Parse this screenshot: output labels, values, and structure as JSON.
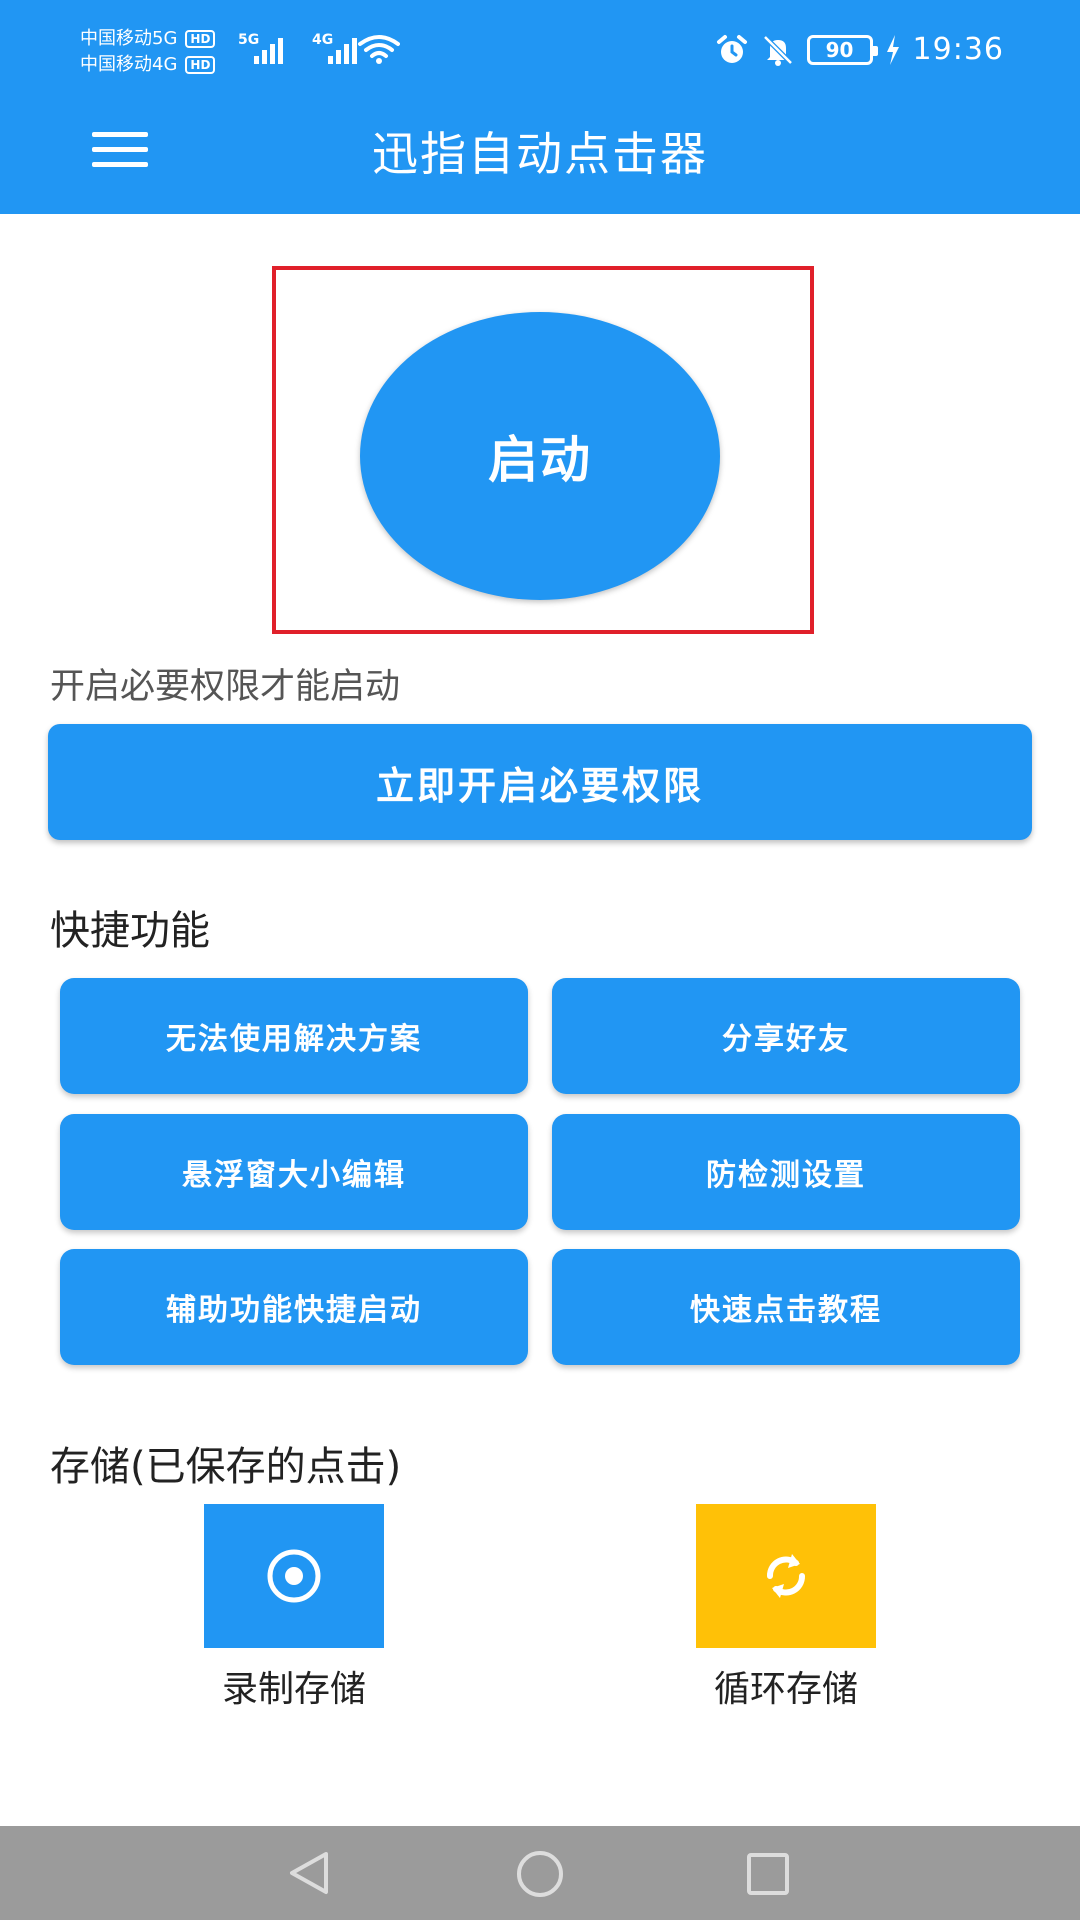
{
  "status_bar": {
    "carrier1": "中国移动5G",
    "carrier2": "中国移动4G",
    "hd": "HD",
    "net1": "5G",
    "net2": "4G",
    "battery": "90",
    "time": "19:36"
  },
  "app_bar": {
    "title": "迅指自动点击器"
  },
  "start": {
    "label": "启动"
  },
  "permission": {
    "hint": "开启必要权限才能启动",
    "button": "立即开启必要权限"
  },
  "quick": {
    "title": "快捷功能",
    "buttons": [
      "无法使用解决方案",
      "分享好友",
      "悬浮窗大小编辑",
      "防检测设置",
      "辅助功能快捷启动",
      "快速点击教程"
    ]
  },
  "storage": {
    "title": "存储(已保存的点击)",
    "record_label": "录制存储",
    "loop_label": "循环存储"
  },
  "colors": {
    "primary": "#2196F3",
    "loop_tile": "#FFC107",
    "frame": "#e0202a",
    "navbar": "#9b9b9b"
  }
}
